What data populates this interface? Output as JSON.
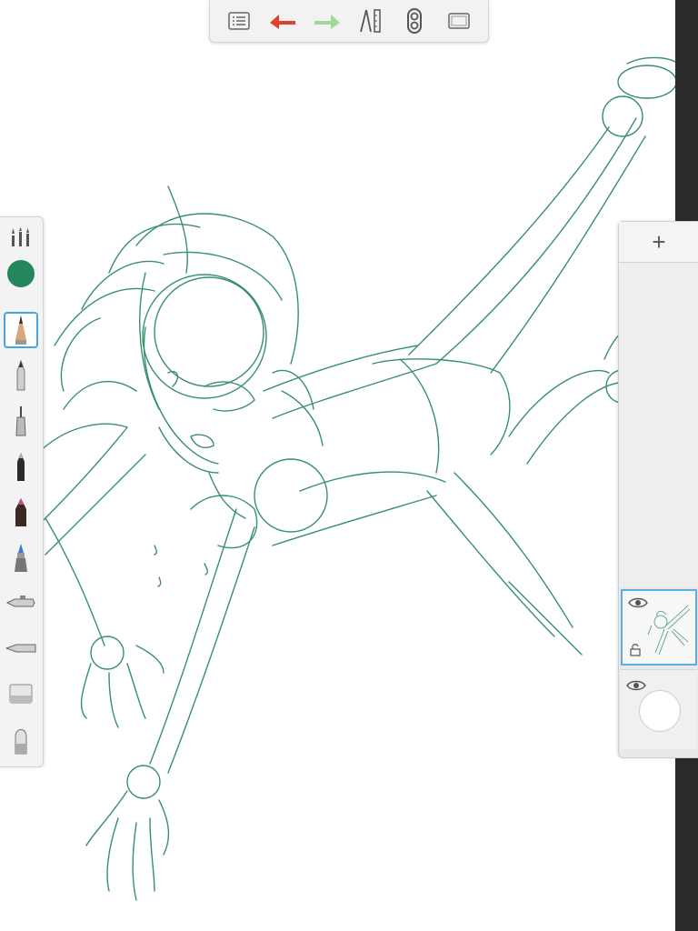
{
  "app": {
    "colors": {
      "stroke": "#2e8b62",
      "undo": "#e0412b",
      "redo": "#9fd99a",
      "toolbar_icon": "#666666",
      "selection": "#4aa3e0",
      "current_brush_color": "#23865c"
    }
  },
  "top_toolbar": [
    {
      "name": "menu-list-icon",
      "role": "menu"
    },
    {
      "name": "undo-arrow-icon",
      "role": "undo"
    },
    {
      "name": "redo-arrow-icon",
      "role": "redo"
    },
    {
      "name": "ruler-compass-icon",
      "role": "guides"
    },
    {
      "name": "copic-color-icon",
      "role": "color"
    },
    {
      "name": "fullscreen-icon",
      "role": "canvas-view"
    }
  ],
  "left_toolbar": {
    "items": [
      {
        "name": "brush-properties-icon"
      },
      {
        "name": "current-color-swatch",
        "color": "#23865c"
      },
      {
        "name": "pencil-tool-icon",
        "selected": true
      },
      {
        "name": "ballpoint-pen-tool-icon"
      },
      {
        "name": "technical-pen-tool-icon"
      },
      {
        "name": "marker-tool-icon"
      },
      {
        "name": "felt-tip-tool-icon"
      },
      {
        "name": "paint-brush-tool-icon"
      },
      {
        "name": "airbrush-tool-icon"
      },
      {
        "name": "smudge-tool-icon"
      },
      {
        "name": "eraser-tool-icon"
      },
      {
        "name": "blender-tool-icon"
      }
    ]
  },
  "layers": {
    "add_label": "+",
    "items": [
      {
        "name": "sketch-layer",
        "visible": true,
        "selected": true
      },
      {
        "name": "background-layer",
        "visible": true,
        "selected": false
      }
    ]
  }
}
